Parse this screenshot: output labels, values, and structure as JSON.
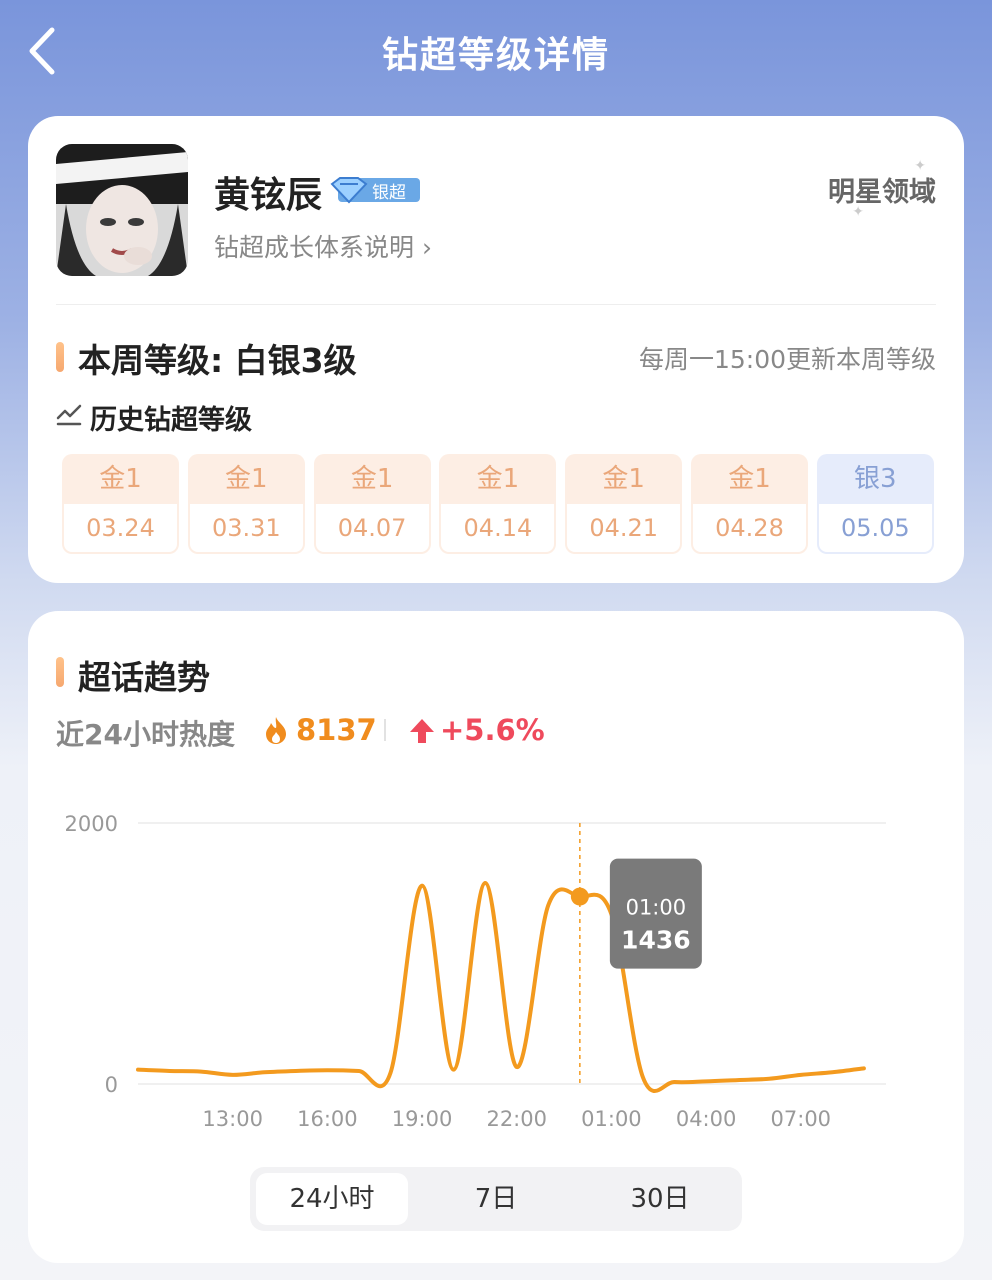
{
  "header": {
    "title": "钻超等级详情"
  },
  "profile": {
    "name": "黄铉辰",
    "badge_label": "银超",
    "system_link": "钻超成长体系说明 ›",
    "domain": "明星领域"
  },
  "level": {
    "week_level": "本周等级: 白银3级",
    "update_note": "每周一15:00更新本周等级",
    "history_title": "历史钻超等级",
    "history": [
      {
        "level": "金1",
        "date": "03.24",
        "tier": "gold"
      },
      {
        "level": "金1",
        "date": "03.31",
        "tier": "gold"
      },
      {
        "level": "金1",
        "date": "04.07",
        "tier": "gold"
      },
      {
        "level": "金1",
        "date": "04.14",
        "tier": "gold"
      },
      {
        "level": "金1",
        "date": "04.21",
        "tier": "gold"
      },
      {
        "level": "金1",
        "date": "04.28",
        "tier": "gold"
      },
      {
        "level": "银3",
        "date": "05.05",
        "tier": "silver"
      }
    ]
  },
  "trend": {
    "title": "超话趋势",
    "heat_label": "近24小时热度",
    "heat_value": "8137",
    "change": "+5.6%",
    "tooltip": {
      "time": "01:00",
      "value": "1436"
    },
    "ranges": [
      "24小时",
      "7日",
      "30日"
    ],
    "active_range": "24小时"
  },
  "chart_data": {
    "type": "line",
    "x_tick_labels": [
      "13:00",
      "16:00",
      "19:00",
      "22:00",
      "01:00",
      "04:00",
      "07:00"
    ],
    "x_hours": [
      10,
      11,
      12,
      13,
      14,
      15,
      16,
      17,
      18,
      19,
      20,
      21,
      22,
      23,
      24,
      25,
      26,
      27,
      28,
      29,
      30,
      31,
      32,
      33
    ],
    "y_axis_ticks": [
      2000,
      0
    ],
    "ylim": [
      0,
      2000
    ],
    "series": [
      {
        "color": "#f39a1e",
        "values": [
          110,
          100,
          95,
          70,
          90,
          100,
          105,
          100,
          85,
          1520,
          110,
          1540,
          130,
          1370,
          1436,
          1300,
          50,
          15,
          20,
          30,
          40,
          70,
          90,
          120
        ]
      }
    ],
    "highlight_index": 14,
    "grid": true,
    "colors": {
      "line": "#f39a1e",
      "heat": "#f08c1e",
      "rise": "#ef4a5c"
    }
  }
}
